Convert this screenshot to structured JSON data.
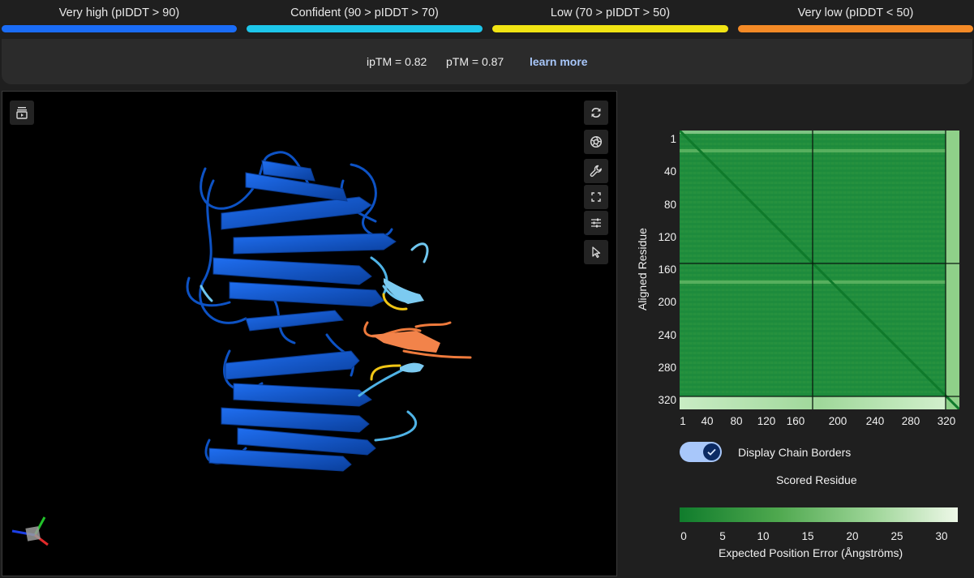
{
  "plddt_legend": [
    {
      "label": "Very high (pIDDT > 90)",
      "color": "#1a6cf7"
    },
    {
      "label": "Confident (90 > pIDDT > 70)",
      "color": "#1dc6ea"
    },
    {
      "label": "Low (70 > pIDDT > 50)",
      "color": "#f1e413"
    },
    {
      "label": "Very low (pIDDT < 50)",
      "color": "#f48a26"
    }
  ],
  "scores": {
    "iptm": "ipTM = 0.82",
    "ptm": "pTM = 0.87",
    "learn_more": "learn more"
  },
  "viewer": {
    "toolbar": [
      "spin-icon",
      "snapshot-icon",
      "wrench-icon",
      "fullscreen-icon",
      "sliders-icon",
      "cursor-icon"
    ],
    "top_left_button": "animation-icon"
  },
  "pae": {
    "y_label": "Aligned Residue",
    "x_label": "Scored Residue",
    "y_ticks": [
      "1",
      "40",
      "80",
      "120",
      "160",
      "200",
      "240",
      "280",
      "320"
    ],
    "x_ticks": [
      "1",
      "40",
      "80",
      "120",
      "160",
      "200",
      "240",
      "280",
      "320"
    ],
    "toggle_label": "Display Chain Borders",
    "toggle_on": true,
    "colorbar_ticks": [
      "0",
      "5",
      "10",
      "15",
      "20",
      "25",
      "30"
    ],
    "colorbar_label": "Expected Position Error (Ångströms)",
    "color_low": "#107c2c",
    "color_high": "#eef8e8"
  }
}
